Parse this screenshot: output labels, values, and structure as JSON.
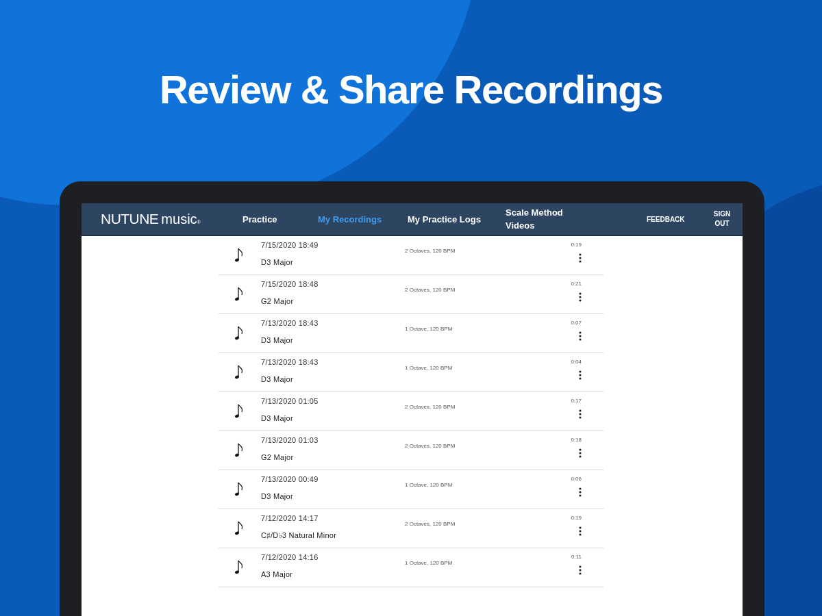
{
  "headline": "Review & Share Recordings",
  "app": {
    "logo": {
      "brand": "NUTUNE",
      "word": "music",
      "mark": "®"
    },
    "nav": [
      {
        "label": "Practice",
        "selected": false,
        "kind": "main"
      },
      {
        "label": "My Recordings",
        "selected": true,
        "kind": "main"
      },
      {
        "label": "My Practice Logs",
        "selected": false,
        "kind": "main"
      },
      {
        "label": "Scale Method Videos",
        "selected": false,
        "kind": "main"
      },
      {
        "label": "FEEDBACK",
        "selected": false,
        "kind": "small"
      },
      {
        "label": "SIGN OUT",
        "selected": false,
        "kind": "small"
      }
    ],
    "recordings": [
      {
        "date": "7/15/2020 18:49",
        "scale": "D3 Major",
        "settings": "2 Octaves, 120 BPM",
        "duration": "0:19"
      },
      {
        "date": "7/15/2020 18:48",
        "scale": "G2 Major",
        "settings": "2 Octaves, 120 BPM",
        "duration": "0:21"
      },
      {
        "date": "7/13/2020 18:43",
        "scale": "D3 Major",
        "settings": "1 Octave, 120 BPM",
        "duration": "0:07"
      },
      {
        "date": "7/13/2020 18:43",
        "scale": "D3 Major",
        "settings": "1 Octave, 120 BPM",
        "duration": "0:04"
      },
      {
        "date": "7/13/2020 01:05",
        "scale": "D3 Major",
        "settings": "2 Octaves, 120 BPM",
        "duration": "0:17"
      },
      {
        "date": "7/13/2020 01:03",
        "scale": "G2 Major",
        "settings": "2 Octaves, 120 BPM",
        "duration": "0:18"
      },
      {
        "date": "7/13/2020 00:49",
        "scale": "D3 Major",
        "settings": "1 Octave, 120 BPM",
        "duration": "0:06"
      },
      {
        "date": "7/12/2020 14:17",
        "scale": "C♯/D♭3 Natural Minor",
        "settings": "2 Octaves, 120 BPM",
        "duration": "0:19"
      },
      {
        "date": "7/12/2020 14:16",
        "scale": "A3 Major",
        "settings": "1 Octave, 120 BPM",
        "duration": "0:11"
      }
    ]
  }
}
